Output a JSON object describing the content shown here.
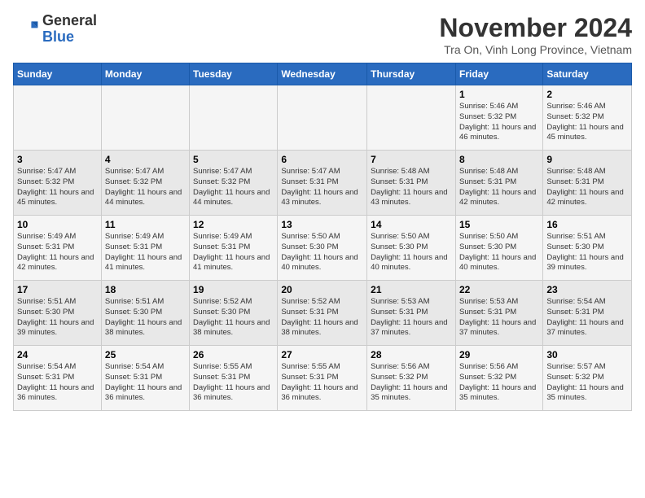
{
  "header": {
    "logo_line1": "General",
    "logo_line2": "Blue",
    "month": "November 2024",
    "location": "Tra On, Vinh Long Province, Vietnam"
  },
  "days_of_week": [
    "Sunday",
    "Monday",
    "Tuesday",
    "Wednesday",
    "Thursday",
    "Friday",
    "Saturday"
  ],
  "weeks": [
    [
      {
        "day": "",
        "info": ""
      },
      {
        "day": "",
        "info": ""
      },
      {
        "day": "",
        "info": ""
      },
      {
        "day": "",
        "info": ""
      },
      {
        "day": "",
        "info": ""
      },
      {
        "day": "1",
        "info": "Sunrise: 5:46 AM\nSunset: 5:32 PM\nDaylight: 11 hours and 46 minutes."
      },
      {
        "day": "2",
        "info": "Sunrise: 5:46 AM\nSunset: 5:32 PM\nDaylight: 11 hours and 45 minutes."
      }
    ],
    [
      {
        "day": "3",
        "info": "Sunrise: 5:47 AM\nSunset: 5:32 PM\nDaylight: 11 hours and 45 minutes."
      },
      {
        "day": "4",
        "info": "Sunrise: 5:47 AM\nSunset: 5:32 PM\nDaylight: 11 hours and 44 minutes."
      },
      {
        "day": "5",
        "info": "Sunrise: 5:47 AM\nSunset: 5:32 PM\nDaylight: 11 hours and 44 minutes."
      },
      {
        "day": "6",
        "info": "Sunrise: 5:47 AM\nSunset: 5:31 PM\nDaylight: 11 hours and 43 minutes."
      },
      {
        "day": "7",
        "info": "Sunrise: 5:48 AM\nSunset: 5:31 PM\nDaylight: 11 hours and 43 minutes."
      },
      {
        "day": "8",
        "info": "Sunrise: 5:48 AM\nSunset: 5:31 PM\nDaylight: 11 hours and 42 minutes."
      },
      {
        "day": "9",
        "info": "Sunrise: 5:48 AM\nSunset: 5:31 PM\nDaylight: 11 hours and 42 minutes."
      }
    ],
    [
      {
        "day": "10",
        "info": "Sunrise: 5:49 AM\nSunset: 5:31 PM\nDaylight: 11 hours and 42 minutes."
      },
      {
        "day": "11",
        "info": "Sunrise: 5:49 AM\nSunset: 5:31 PM\nDaylight: 11 hours and 41 minutes."
      },
      {
        "day": "12",
        "info": "Sunrise: 5:49 AM\nSunset: 5:31 PM\nDaylight: 11 hours and 41 minutes."
      },
      {
        "day": "13",
        "info": "Sunrise: 5:50 AM\nSunset: 5:30 PM\nDaylight: 11 hours and 40 minutes."
      },
      {
        "day": "14",
        "info": "Sunrise: 5:50 AM\nSunset: 5:30 PM\nDaylight: 11 hours and 40 minutes."
      },
      {
        "day": "15",
        "info": "Sunrise: 5:50 AM\nSunset: 5:30 PM\nDaylight: 11 hours and 40 minutes."
      },
      {
        "day": "16",
        "info": "Sunrise: 5:51 AM\nSunset: 5:30 PM\nDaylight: 11 hours and 39 minutes."
      }
    ],
    [
      {
        "day": "17",
        "info": "Sunrise: 5:51 AM\nSunset: 5:30 PM\nDaylight: 11 hours and 39 minutes."
      },
      {
        "day": "18",
        "info": "Sunrise: 5:51 AM\nSunset: 5:30 PM\nDaylight: 11 hours and 38 minutes."
      },
      {
        "day": "19",
        "info": "Sunrise: 5:52 AM\nSunset: 5:30 PM\nDaylight: 11 hours and 38 minutes."
      },
      {
        "day": "20",
        "info": "Sunrise: 5:52 AM\nSunset: 5:31 PM\nDaylight: 11 hours and 38 minutes."
      },
      {
        "day": "21",
        "info": "Sunrise: 5:53 AM\nSunset: 5:31 PM\nDaylight: 11 hours and 37 minutes."
      },
      {
        "day": "22",
        "info": "Sunrise: 5:53 AM\nSunset: 5:31 PM\nDaylight: 11 hours and 37 minutes."
      },
      {
        "day": "23",
        "info": "Sunrise: 5:54 AM\nSunset: 5:31 PM\nDaylight: 11 hours and 37 minutes."
      }
    ],
    [
      {
        "day": "24",
        "info": "Sunrise: 5:54 AM\nSunset: 5:31 PM\nDaylight: 11 hours and 36 minutes."
      },
      {
        "day": "25",
        "info": "Sunrise: 5:54 AM\nSunset: 5:31 PM\nDaylight: 11 hours and 36 minutes."
      },
      {
        "day": "26",
        "info": "Sunrise: 5:55 AM\nSunset: 5:31 PM\nDaylight: 11 hours and 36 minutes."
      },
      {
        "day": "27",
        "info": "Sunrise: 5:55 AM\nSunset: 5:31 PM\nDaylight: 11 hours and 36 minutes."
      },
      {
        "day": "28",
        "info": "Sunrise: 5:56 AM\nSunset: 5:32 PM\nDaylight: 11 hours and 35 minutes."
      },
      {
        "day": "29",
        "info": "Sunrise: 5:56 AM\nSunset: 5:32 PM\nDaylight: 11 hours and 35 minutes."
      },
      {
        "day": "30",
        "info": "Sunrise: 5:57 AM\nSunset: 5:32 PM\nDaylight: 11 hours and 35 minutes."
      }
    ]
  ]
}
